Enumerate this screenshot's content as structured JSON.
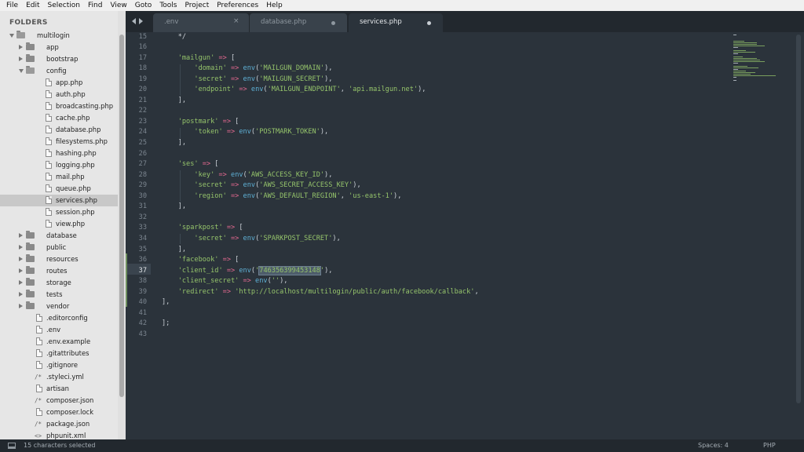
{
  "menu": [
    "File",
    "Edit",
    "Selection",
    "Find",
    "View",
    "Goto",
    "Tools",
    "Project",
    "Preferences",
    "Help"
  ],
  "sidebar": {
    "title": "FOLDERS",
    "tree": [
      {
        "label": "multilogin",
        "type": "folder",
        "depth": 0,
        "expanded": true
      },
      {
        "label": "app",
        "type": "folder",
        "depth": 1,
        "expanded": false
      },
      {
        "label": "bootstrap",
        "type": "folder",
        "depth": 1,
        "expanded": false
      },
      {
        "label": "config",
        "type": "folder",
        "depth": 1,
        "expanded": true
      },
      {
        "label": "app.php",
        "type": "file",
        "depth": 2
      },
      {
        "label": "auth.php",
        "type": "file",
        "depth": 2
      },
      {
        "label": "broadcasting.php",
        "type": "file",
        "depth": 2
      },
      {
        "label": "cache.php",
        "type": "file",
        "depth": 2
      },
      {
        "label": "database.php",
        "type": "file",
        "depth": 2
      },
      {
        "label": "filesystems.php",
        "type": "file",
        "depth": 2
      },
      {
        "label": "hashing.php",
        "type": "file",
        "depth": 2
      },
      {
        "label": "logging.php",
        "type": "file",
        "depth": 2
      },
      {
        "label": "mail.php",
        "type": "file",
        "depth": 2
      },
      {
        "label": "queue.php",
        "type": "file",
        "depth": 2
      },
      {
        "label": "services.php",
        "type": "file",
        "depth": 2,
        "selected": true
      },
      {
        "label": "session.php",
        "type": "file",
        "depth": 2
      },
      {
        "label": "view.php",
        "type": "file",
        "depth": 2
      },
      {
        "label": "database",
        "type": "folder",
        "depth": 1,
        "expanded": false
      },
      {
        "label": "public",
        "type": "folder",
        "depth": 1,
        "expanded": false
      },
      {
        "label": "resources",
        "type": "folder",
        "depth": 1,
        "expanded": false
      },
      {
        "label": "routes",
        "type": "folder",
        "depth": 1,
        "expanded": false
      },
      {
        "label": "storage",
        "type": "folder",
        "depth": 1,
        "expanded": false
      },
      {
        "label": "tests",
        "type": "folder",
        "depth": 1,
        "expanded": false
      },
      {
        "label": "vendor",
        "type": "folder",
        "depth": 1,
        "expanded": false
      },
      {
        "label": ".editorconfig",
        "type": "file",
        "depth": 1
      },
      {
        "label": ".env",
        "type": "file",
        "depth": 1
      },
      {
        "label": ".env.example",
        "type": "file",
        "depth": 1
      },
      {
        "label": ".gitattributes",
        "type": "file",
        "depth": 1
      },
      {
        "label": ".gitignore",
        "type": "file",
        "depth": 1
      },
      {
        "label": ".styleci.yml",
        "type": "glyph",
        "glyph": "/*",
        "depth": 1
      },
      {
        "label": "artisan",
        "type": "file",
        "depth": 1
      },
      {
        "label": "composer.json",
        "type": "glyph",
        "glyph": "/*",
        "depth": 1
      },
      {
        "label": "composer.lock",
        "type": "file",
        "depth": 1
      },
      {
        "label": "package.json",
        "type": "glyph",
        "glyph": "/*",
        "depth": 1
      },
      {
        "label": "phpunit.xml",
        "type": "glyph",
        "glyph": "<>",
        "depth": 1
      }
    ]
  },
  "tabs": [
    {
      "label": ".env",
      "state": "close",
      "active": false
    },
    {
      "label": "database.php",
      "state": "dot",
      "active": false
    },
    {
      "label": "services.php",
      "state": "dot",
      "active": true
    }
  ],
  "editor": {
    "current_line": 37,
    "lines": [
      {
        "n": 15,
        "tokens": [
          [
            "c",
            "    */"
          ]
        ]
      },
      {
        "n": 16,
        "tokens": []
      },
      {
        "n": 17,
        "tokens": [
          [
            "p",
            "    "
          ],
          [
            "s",
            "'mailgun'"
          ],
          [
            "p",
            " "
          ],
          [
            "o",
            "=>"
          ],
          [
            "p",
            " ["
          ]
        ]
      },
      {
        "n": 18,
        "tokens": [
          [
            "p",
            "        "
          ],
          [
            "s",
            "'domain'"
          ],
          [
            "p",
            " "
          ],
          [
            "o",
            "=>"
          ],
          [
            "p",
            " "
          ],
          [
            "f",
            "env"
          ],
          [
            "p",
            "("
          ],
          [
            "s",
            "'MAILGUN_DOMAIN'"
          ],
          [
            "p",
            "),"
          ]
        ]
      },
      {
        "n": 19,
        "tokens": [
          [
            "p",
            "        "
          ],
          [
            "s",
            "'secret'"
          ],
          [
            "p",
            " "
          ],
          [
            "o",
            "=>"
          ],
          [
            "p",
            " "
          ],
          [
            "f",
            "env"
          ],
          [
            "p",
            "("
          ],
          [
            "s",
            "'MAILGUN_SECRET'"
          ],
          [
            "p",
            "),"
          ]
        ]
      },
      {
        "n": 20,
        "tokens": [
          [
            "p",
            "        "
          ],
          [
            "s",
            "'endpoint'"
          ],
          [
            "p",
            " "
          ],
          [
            "o",
            "=>"
          ],
          [
            "p",
            " "
          ],
          [
            "f",
            "env"
          ],
          [
            "p",
            "("
          ],
          [
            "s",
            "'MAILGUN_ENDPOINT'"
          ],
          [
            "p",
            ", "
          ],
          [
            "s",
            "'api.mailgun.net'"
          ],
          [
            "p",
            "),"
          ]
        ]
      },
      {
        "n": 21,
        "tokens": [
          [
            "p",
            "    ],"
          ]
        ]
      },
      {
        "n": 22,
        "tokens": []
      },
      {
        "n": 23,
        "tokens": [
          [
            "p",
            "    "
          ],
          [
            "s",
            "'postmark'"
          ],
          [
            "p",
            " "
          ],
          [
            "o",
            "=>"
          ],
          [
            "p",
            " ["
          ]
        ]
      },
      {
        "n": 24,
        "tokens": [
          [
            "p",
            "        "
          ],
          [
            "s",
            "'token'"
          ],
          [
            "p",
            " "
          ],
          [
            "o",
            "=>"
          ],
          [
            "p",
            " "
          ],
          [
            "f",
            "env"
          ],
          [
            "p",
            "("
          ],
          [
            "s",
            "'POSTMARK_TOKEN'"
          ],
          [
            "p",
            "),"
          ]
        ]
      },
      {
        "n": 25,
        "tokens": [
          [
            "p",
            "    ],"
          ]
        ]
      },
      {
        "n": 26,
        "tokens": []
      },
      {
        "n": 27,
        "tokens": [
          [
            "p",
            "    "
          ],
          [
            "s",
            "'ses'"
          ],
          [
            "p",
            " "
          ],
          [
            "o",
            "=>"
          ],
          [
            "p",
            " ["
          ]
        ]
      },
      {
        "n": 28,
        "tokens": [
          [
            "p",
            "        "
          ],
          [
            "s",
            "'key'"
          ],
          [
            "p",
            " "
          ],
          [
            "o",
            "=>"
          ],
          [
            "p",
            " "
          ],
          [
            "f",
            "env"
          ],
          [
            "p",
            "("
          ],
          [
            "s",
            "'AWS_ACCESS_KEY_ID'"
          ],
          [
            "p",
            "),"
          ]
        ]
      },
      {
        "n": 29,
        "tokens": [
          [
            "p",
            "        "
          ],
          [
            "s",
            "'secret'"
          ],
          [
            "p",
            " "
          ],
          [
            "o",
            "=>"
          ],
          [
            "p",
            " "
          ],
          [
            "f",
            "env"
          ],
          [
            "p",
            "("
          ],
          [
            "s",
            "'AWS_SECRET_ACCESS_KEY'"
          ],
          [
            "p",
            "),"
          ]
        ]
      },
      {
        "n": 30,
        "tokens": [
          [
            "p",
            "        "
          ],
          [
            "s",
            "'region'"
          ],
          [
            "p",
            " "
          ],
          [
            "o",
            "=>"
          ],
          [
            "p",
            " "
          ],
          [
            "f",
            "env"
          ],
          [
            "p",
            "("
          ],
          [
            "s",
            "'AWS_DEFAULT_REGION'"
          ],
          [
            "p",
            ", "
          ],
          [
            "s",
            "'us-east-1'"
          ],
          [
            "p",
            "),"
          ]
        ]
      },
      {
        "n": 31,
        "tokens": [
          [
            "p",
            "    ],"
          ]
        ]
      },
      {
        "n": 32,
        "tokens": []
      },
      {
        "n": 33,
        "tokens": [
          [
            "p",
            "    "
          ],
          [
            "s",
            "'sparkpost'"
          ],
          [
            "p",
            " "
          ],
          [
            "o",
            "=>"
          ],
          [
            "p",
            " ["
          ]
        ]
      },
      {
        "n": 34,
        "tokens": [
          [
            "p",
            "        "
          ],
          [
            "s",
            "'secret'"
          ],
          [
            "p",
            " "
          ],
          [
            "o",
            "=>"
          ],
          [
            "p",
            " "
          ],
          [
            "f",
            "env"
          ],
          [
            "p",
            "("
          ],
          [
            "s",
            "'SPARKPOST_SECRET'"
          ],
          [
            "p",
            "),"
          ]
        ]
      },
      {
        "n": 35,
        "tokens": [
          [
            "p",
            "    ],"
          ]
        ]
      },
      {
        "n": 36,
        "tokens": [
          [
            "p",
            "    "
          ],
          [
            "s",
            "'facebook'"
          ],
          [
            "p",
            " "
          ],
          [
            "o",
            "=>"
          ],
          [
            "p",
            " ["
          ]
        ]
      },
      {
        "n": 37,
        "tokens": [
          [
            "p",
            "    "
          ],
          [
            "s",
            "'client_id'"
          ],
          [
            "p",
            " "
          ],
          [
            "o",
            "=>"
          ],
          [
            "p",
            " "
          ],
          [
            "f",
            "env"
          ],
          [
            "p",
            "("
          ],
          [
            "s",
            "'"
          ],
          [
            "sel",
            "746356399453148"
          ],
          [
            "s",
            "'"
          ],
          [
            "p",
            "),"
          ]
        ]
      },
      {
        "n": 38,
        "tokens": [
          [
            "p",
            "    "
          ],
          [
            "s",
            "'client_secret'"
          ],
          [
            "p",
            " "
          ],
          [
            "o",
            "=>"
          ],
          [
            "p",
            " "
          ],
          [
            "f",
            "env"
          ],
          [
            "p",
            "("
          ],
          [
            "s",
            "''"
          ],
          [
            "p",
            "),"
          ]
        ]
      },
      {
        "n": 39,
        "tokens": [
          [
            "p",
            "    "
          ],
          [
            "s",
            "'redirect'"
          ],
          [
            "p",
            " "
          ],
          [
            "o",
            "=>"
          ],
          [
            "p",
            " "
          ],
          [
            "s",
            "'http://localhost/multilogin/public/auth/facebook/callback'"
          ],
          [
            "p",
            ","
          ]
        ]
      },
      {
        "n": 40,
        "tokens": [
          [
            "p",
            "],"
          ]
        ]
      },
      {
        "n": 41,
        "tokens": []
      },
      {
        "n": 42,
        "tokens": [
          [
            "p",
            "];"
          ]
        ]
      },
      {
        "n": 43,
        "tokens": []
      }
    ]
  },
  "status": {
    "selection": "15 characters selected",
    "spaces": "Spaces: 4",
    "syntax": "PHP"
  },
  "icons": {
    "sidebar_panel": "panel-toggle-icon",
    "nav_prev": "chevron-left-icon",
    "nav_next": "chevron-right-icon"
  },
  "colors": {
    "editor_bg": "#2b333b",
    "string": "#95c46b",
    "operator": "#e2688f",
    "function": "#5fb1d6"
  }
}
